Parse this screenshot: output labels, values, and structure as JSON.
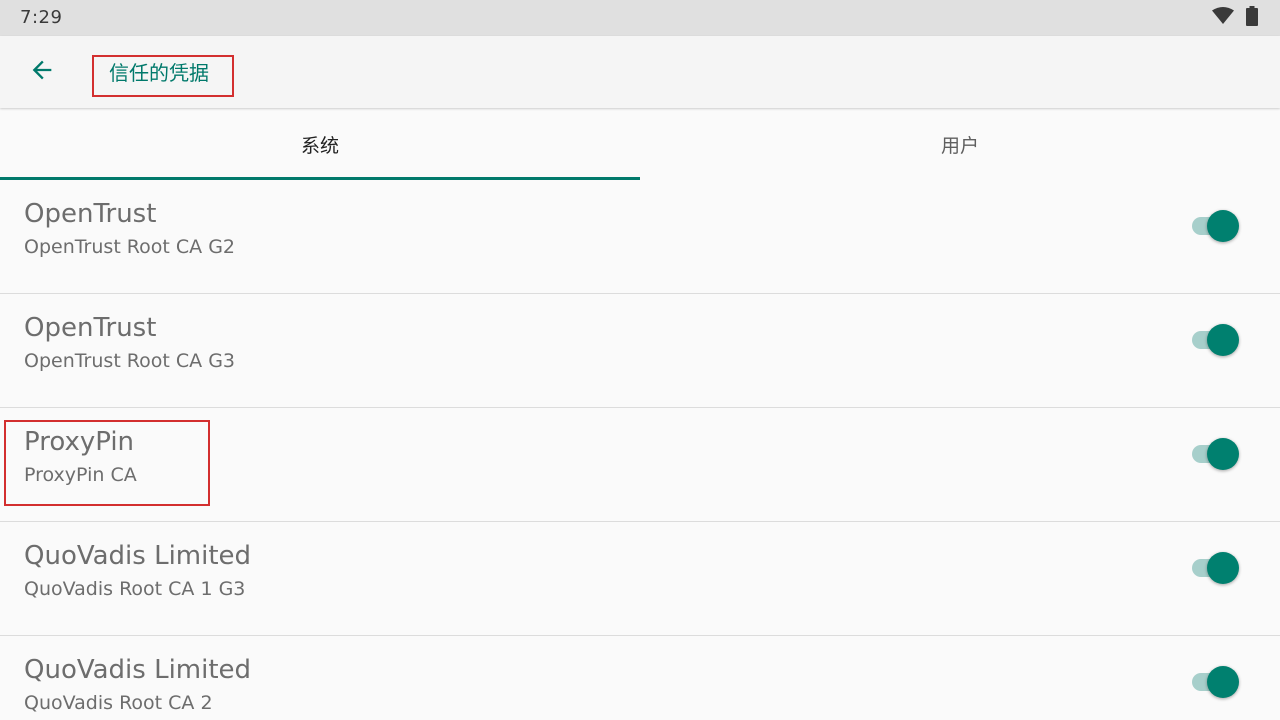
{
  "status_bar": {
    "time": "7:29",
    "icons": [
      "wifi-icon",
      "battery-icon"
    ]
  },
  "app_bar": {
    "back_icon": "arrow-left-icon",
    "title": "信任的凭据"
  },
  "tabs": [
    {
      "label": "系统",
      "selected": true
    },
    {
      "label": "用户",
      "selected": false
    }
  ],
  "certificates": [
    {
      "title": "OpenTrust",
      "subtitle": "OpenTrust Root CA G2",
      "enabled": true
    },
    {
      "title": "OpenTrust",
      "subtitle": "OpenTrust Root CA G3",
      "enabled": true
    },
    {
      "title": "ProxyPin",
      "subtitle": "ProxyPin CA",
      "enabled": true
    },
    {
      "title": "QuoVadis Limited",
      "subtitle": "QuoVadis Root CA 1 G3",
      "enabled": true
    },
    {
      "title": "QuoVadis Limited",
      "subtitle": "QuoVadis Root CA 2",
      "enabled": true
    }
  ],
  "colors": {
    "accent": "#00796b",
    "switch_thumb": "#00806f",
    "switch_track": "#a7cfcb",
    "highlight": "#d32f2f"
  }
}
